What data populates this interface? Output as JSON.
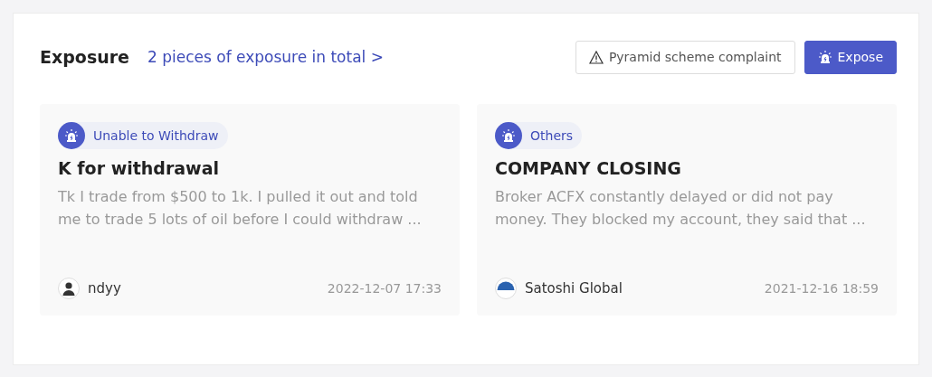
{
  "header": {
    "title": "Exposure",
    "total_link": "2 pieces of exposure in total",
    "total_chevron": ">"
  },
  "buttons": [
    {
      "kind": "outline",
      "label": "Pyramid scheme complaint"
    },
    {
      "kind": "primary",
      "label": "Expose"
    }
  ],
  "cards": [
    {
      "tag": "Unable to Withdraw",
      "title": "K for withdrawal",
      "body": "Tk I trade from $500 to 1k. I pulled it out and told me to trade 5 lots of oil before I could withdraw ...",
      "author": {
        "kind": "person",
        "name": "ndyy"
      },
      "time": "2022-12-07 17:33"
    },
    {
      "tag": "Others",
      "title": "COMPANY CLOSING",
      "body": "Broker ACFX constantly delayed or did not pay money. They blocked my account, they said that ...",
      "author": {
        "kind": "logo",
        "name": "Satoshi Global"
      },
      "time": "2021-12-16 18:59"
    }
  ]
}
